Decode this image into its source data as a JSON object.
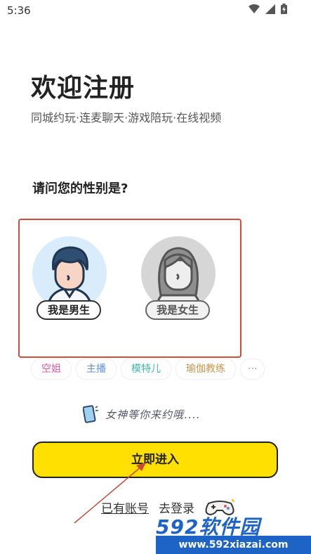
{
  "status_bar": {
    "time": "5:36"
  },
  "header": {
    "title": "欢迎注册",
    "subtitle": "同城约玩·连麦聊天·游戏陪玩·在线视频"
  },
  "gender": {
    "question": "请问您的性别是?",
    "male_label": "我是男生",
    "female_label": "我是女生"
  },
  "tags": [
    {
      "label": "空姐",
      "color": "#e05aa0"
    },
    {
      "label": "主播",
      "color": "#5f8ed8"
    },
    {
      "label": "模特儿",
      "color": "#3fb8b0"
    },
    {
      "label": "瑜伽教练",
      "color": "#c8954a"
    },
    {
      "label": "···",
      "color": "#e08a60"
    }
  ],
  "goddess_text": "女神等你来约哦....",
  "enter_button": "立即进入",
  "login": {
    "has_account": "已有账号",
    "login_link": "去登录"
  },
  "watermark": {
    "brand": "592软件园",
    "url": "www.592xiazai.com"
  },
  "colors": {
    "accent": "#ffe000",
    "highlight": "#d74b3a",
    "watermark": "#1e63c6"
  }
}
